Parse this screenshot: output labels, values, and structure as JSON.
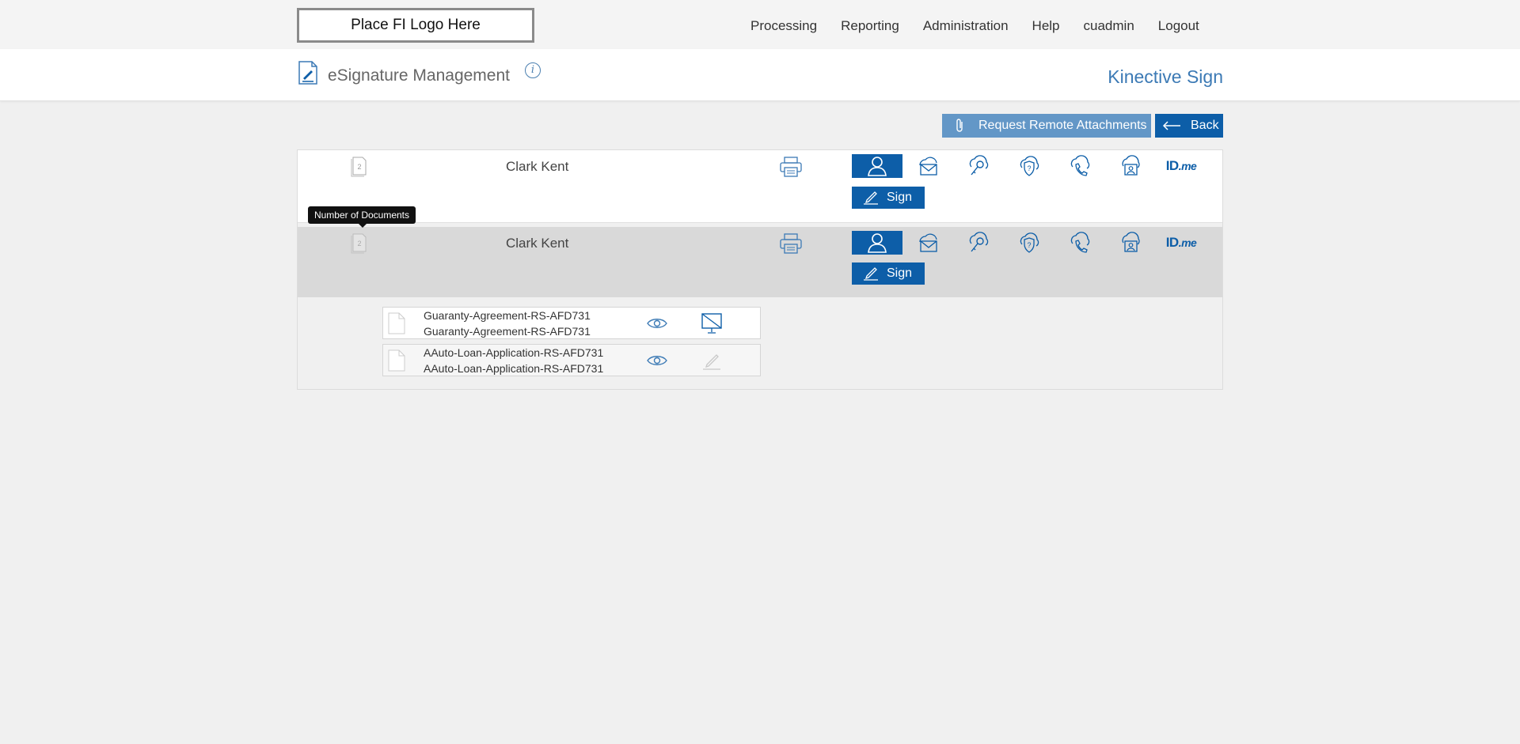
{
  "topbar": {
    "logo_text": "Place FI Logo Here",
    "nav": [
      "Processing",
      "Reporting",
      "Administration",
      "Help",
      "cuadmin",
      "Logout"
    ]
  },
  "header": {
    "title": "eSignature Management",
    "info": "i",
    "brand": "Kinective Sign"
  },
  "actions": {
    "attach_label": "Request Remote Attachments",
    "back_label": "Back"
  },
  "signers": [
    {
      "doc_count": "2",
      "name": "Clark Kent",
      "sign_label": "Sign"
    },
    {
      "doc_count": "2",
      "name": "Clark Kent",
      "sign_label": "Sign"
    }
  ],
  "auth_icons": [
    "in-person-icon",
    "email-icon",
    "passcode-key-icon",
    "security-question-icon",
    "phone-icon",
    "remote-id-icon",
    "idme-logo"
  ],
  "idme": {
    "id": "ID",
    "me": ".me"
  },
  "tooltip": "Number of Documents",
  "documents": [
    {
      "line1": "Guaranty-Agreement-RS-AFD731",
      "line2": "Guaranty-Agreement-RS-AFD731",
      "action_icon": "kiosk-disabled-icon"
    },
    {
      "line1": "AAuto-Loan-Application-RS-AFD731",
      "line2": "AAuto-Loan-Application-RS-AFD731",
      "action_icon": "sign-disabled-icon"
    }
  ],
  "colors": {
    "primary": "#0d5ea8",
    "secondary": "#6397c7",
    "brand": "#3c7ab5"
  }
}
